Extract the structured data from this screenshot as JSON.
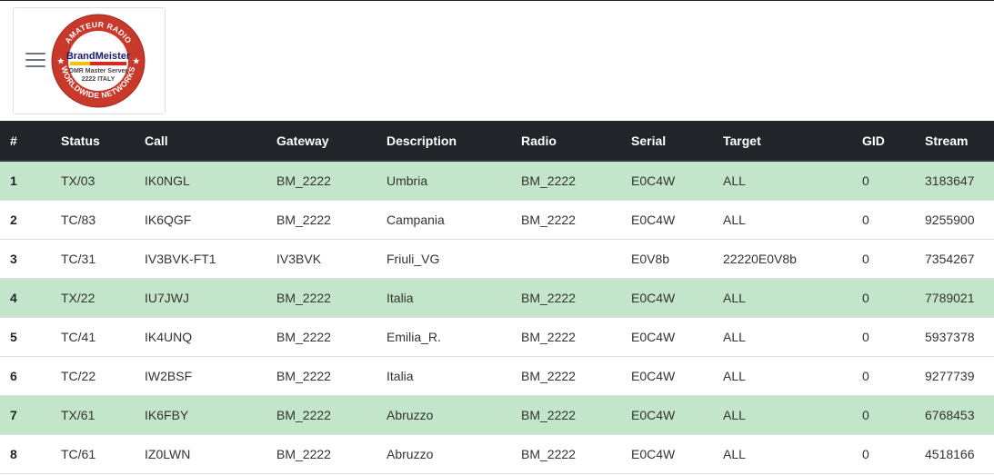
{
  "logo": {
    "title": "BrandMeister",
    "subtitle": "DMR Master Server",
    "region": "2222 ITALY",
    "ring_top": "AMATEUR RADIO",
    "ring_bottom": "WORLDWIDE NETWORKS",
    "colors": {
      "ring": "#c8392b",
      "inner": "#ffffff",
      "stripe_red": "#d62a1e",
      "stripe_yellow": "#f4c20d"
    }
  },
  "table": {
    "headers": [
      "#",
      "Status",
      "Call",
      "Gateway",
      "Description",
      "Radio",
      "Serial",
      "Target",
      "GID",
      "Stream"
    ],
    "rows": [
      {
        "n": "1",
        "status": "TX/03",
        "call": "IK0NGL",
        "gateway": "BM_2222",
        "description": "Umbria",
        "radio": "BM_2222",
        "serial": "E0C4W",
        "target": "ALL",
        "gid": "0",
        "stream": "3183647",
        "tx": true
      },
      {
        "n": "2",
        "status": "TC/83",
        "call": "IK6QGF",
        "gateway": "BM_2222",
        "description": "Campania",
        "radio": "BM_2222",
        "serial": "E0C4W",
        "target": "ALL",
        "gid": "0",
        "stream": "9255900",
        "tx": false
      },
      {
        "n": "3",
        "status": "TC/31",
        "call": "IV3BVK-FT1",
        "gateway": "IV3BVK",
        "description": "Friuli_VG",
        "radio": "",
        "serial": "E0V8b",
        "target": "22220E0V8b",
        "gid": "0",
        "stream": "7354267",
        "tx": false
      },
      {
        "n": "4",
        "status": "TX/22",
        "call": "IU7JWJ",
        "gateway": "BM_2222",
        "description": "Italia",
        "radio": "BM_2222",
        "serial": "E0C4W",
        "target": "ALL",
        "gid": "0",
        "stream": "7789021",
        "tx": true
      },
      {
        "n": "5",
        "status": "TC/41",
        "call": "IK4UNQ",
        "gateway": "BM_2222",
        "description": "Emilia_R.",
        "radio": "BM_2222",
        "serial": "E0C4W",
        "target": "ALL",
        "gid": "0",
        "stream": "5937378",
        "tx": false
      },
      {
        "n": "6",
        "status": "TC/22",
        "call": "IW2BSF",
        "gateway": "BM_2222",
        "description": "Italia",
        "radio": "BM_2222",
        "serial": "E0C4W",
        "target": "ALL",
        "gid": "0",
        "stream": "9277739",
        "tx": false
      },
      {
        "n": "7",
        "status": "TX/61",
        "call": "IK6FBY",
        "gateway": "BM_2222",
        "description": "Abruzzo",
        "radio": "BM_2222",
        "serial": "E0C4W",
        "target": "ALL",
        "gid": "0",
        "stream": "6768453",
        "tx": true
      },
      {
        "n": "8",
        "status": "TC/61",
        "call": "IZ0LWN",
        "gateway": "BM_2222",
        "description": "Abruzzo",
        "radio": "BM_2222",
        "serial": "E0C4W",
        "target": "ALL",
        "gid": "0",
        "stream": "4518166",
        "tx": false
      }
    ],
    "colors": {
      "header_bg": "#212529",
      "tx_row_bg": "#c3e6cb"
    }
  }
}
